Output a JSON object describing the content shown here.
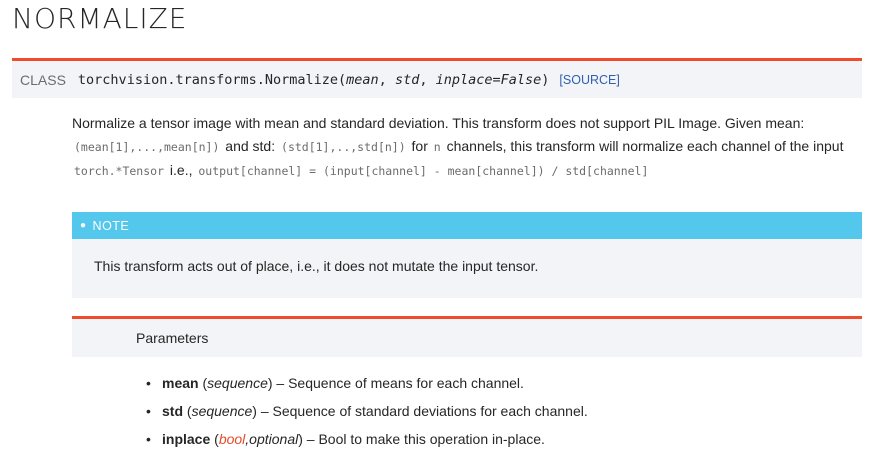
{
  "page_title": "NORMALIZE",
  "signature": {
    "class_label": "CLASS",
    "name": "torchvision.transforms.Normalize(",
    "param_mean": "mean",
    "sep1": ",",
    "param_std": "std",
    "sep2": ",",
    "param_inplace": "inplace=False",
    "close": ")",
    "source_link": "[SOURCE]"
  },
  "description": {
    "t1": "Normalize a tensor image with mean and standard deviation. This transform does not support PIL Image. Given mean:",
    "c1": "(mean[1],...,mean[n])",
    "t2": "and std:",
    "c2": "(std[1],..,std[n])",
    "t3": "for",
    "c3": "n",
    "t4": "channels, this transform will normalize each channel of the",
    "t5": "input",
    "c4": "torch.*Tensor",
    "t6": "i.e.,",
    "c5": "output[channel] = (input[channel] - mean[channel]) / std[channel]"
  },
  "note": {
    "header": "NOTE",
    "body": "This transform acts out of place, i.e., it does not mutate the input tensor."
  },
  "parameters": {
    "label": "Parameters",
    "items": [
      {
        "name": "mean",
        "type": "sequence",
        "desc": "– Sequence of means for each channel."
      },
      {
        "name": "std",
        "type": "sequence",
        "desc": "– Sequence of standard deviations for each channel."
      },
      {
        "name": "inplace",
        "type_red": "bool",
        "type_rest": ",optional",
        "desc": "– Bool to make this operation in-place."
      }
    ]
  },
  "colors": {
    "accent_red": "#ee4c2c",
    "note_blue": "#54c7ec",
    "link_blue": "#2f5fb3",
    "panel_gray": "#f3f4f7"
  }
}
